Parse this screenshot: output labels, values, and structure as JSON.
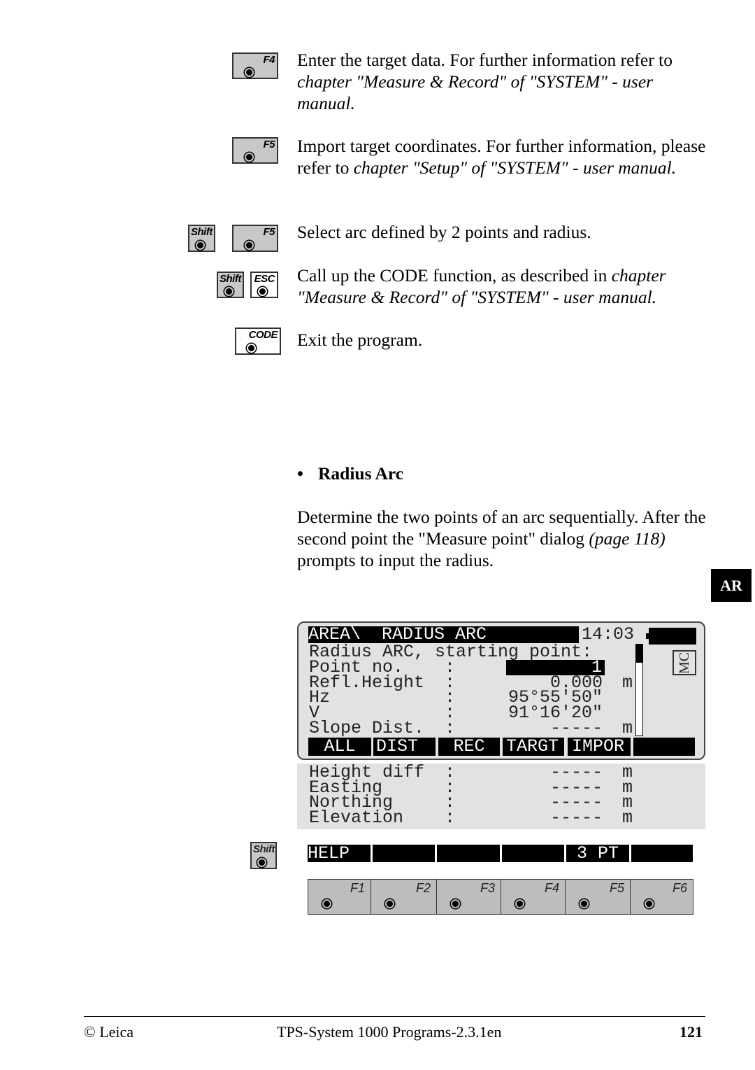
{
  "instructions": [
    {
      "keys": [
        "F4"
      ],
      "text_plain": "Enter the target data. For further information refer to ",
      "text_italic": "chapter \"Measure & Record\" of \"SYSTEM\" - user manual."
    },
    {
      "keys": [
        "F5"
      ],
      "text_plain": "Import target coordinates. For further information, please refer to ",
      "text_italic": "chapter \"Setup\" of \"SYSTEM\" - user manual."
    },
    {
      "keys": [
        "Shift",
        "F5"
      ],
      "text_plain": "Select arc defined by 2 points and radius.",
      "text_italic": ""
    },
    {
      "keys": [
        "Shift",
        "ESC"
      ],
      "text_plain": "Call up the CODE function, as described in ",
      "text_italic": "chapter \"Measure & Record\" of \"SYSTEM\" - user manual."
    },
    {
      "keys": [
        "CODE"
      ],
      "text_plain": "Exit the program.",
      "text_italic": ""
    }
  ],
  "section": {
    "bullet": "•",
    "title": "Radius Arc",
    "text1": "Determine the two points of an arc sequentially. After the second point the \"Measure point\" dialog ",
    "text_ref": "(page 118)",
    "text2": " prompts to input the radius."
  },
  "side_tab": "AR",
  "screen": {
    "title": "AREA\\  RADIUS ARC",
    "time": "14:03",
    "mc": "MC",
    "subtitle": "Radius ARC, starting point:",
    "rows": [
      {
        "label": "Point no.",
        "value": "1",
        "unit": ""
      },
      {
        "label": "Refl.Height",
        "value": "0.000",
        "unit": "m"
      },
      {
        "label": "Hz",
        "value": "95°55'50\"",
        "unit": ""
      },
      {
        "label": "V",
        "value": "91°16'20\"",
        "unit": ""
      },
      {
        "label": "Slope Dist.",
        "value": "-----",
        "unit": "m"
      }
    ],
    "softkeys": [
      "ALL",
      "DIST",
      "REC",
      "TARGT",
      "IMPOR",
      ""
    ],
    "extra_rows": [
      {
        "label": "Height diff",
        "value": "-----",
        "unit": "m"
      },
      {
        "label": "Easting",
        "value": "-----",
        "unit": "m"
      },
      {
        "label": "Northing",
        "value": "-----",
        "unit": "m"
      },
      {
        "label": "Elevation",
        "value": "-----",
        "unit": "m"
      }
    ],
    "shift_key": "Shift",
    "shift_softkeys": [
      "HELP",
      "",
      "",
      "",
      "3 PT",
      ""
    ],
    "fkeys": [
      "F1",
      "F2",
      "F3",
      "F4",
      "F5",
      "F6"
    ],
    "colon": ":"
  },
  "footer": {
    "left": "© Leica",
    "center": "TPS-System 1000 Programs-2.3.1en",
    "page": "121"
  }
}
